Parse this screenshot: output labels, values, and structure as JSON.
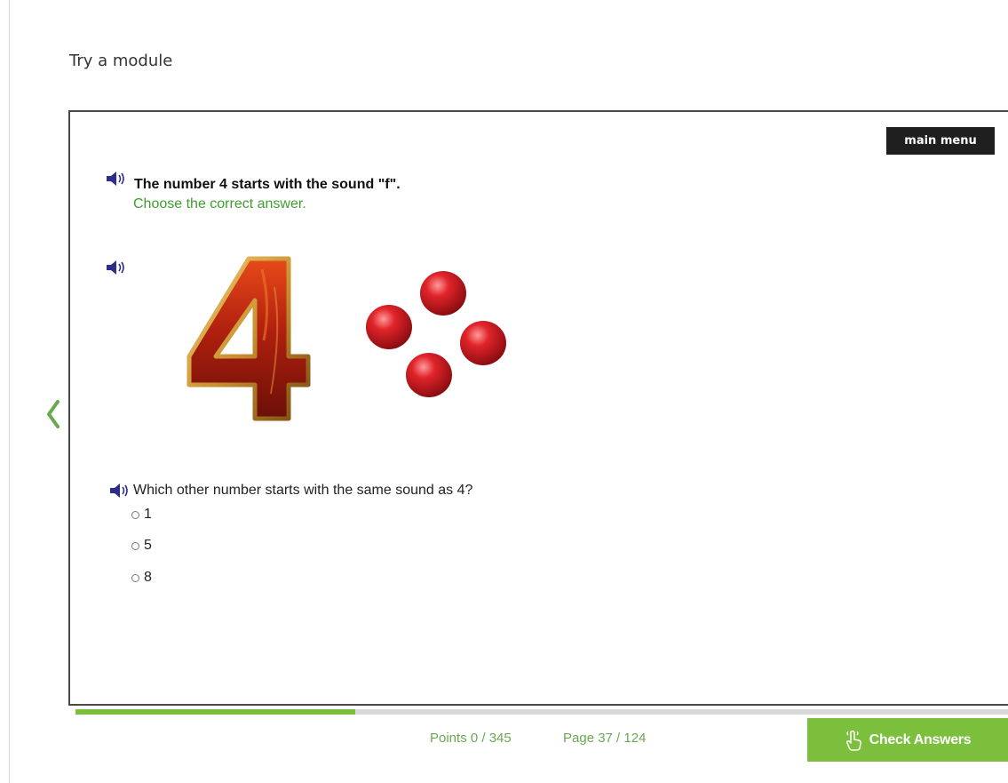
{
  "page": {
    "heading": "Try a module"
  },
  "module": {
    "main_menu_label": "main menu",
    "instruction": {
      "title": "The number 4 starts with the sound \"f\".",
      "subtitle": "Choose the correct answer."
    },
    "illustration": {
      "numeral": "4",
      "counter_count": 4
    },
    "question": {
      "text": "Which other number starts with the same sound as 4?",
      "options": [
        {
          "label": "1"
        },
        {
          "label": "5"
        },
        {
          "label": "8"
        }
      ]
    }
  },
  "footer": {
    "points": "Points 0 / 345",
    "page": "Page 37 / 124",
    "check_answers_label": "Check Answers",
    "progress_fraction": 0.3
  },
  "colors": {
    "accent_green": "#7cbf3d",
    "instruction_green": "#3e9e2e",
    "status_green": "#6aa84f",
    "speaker_blue": "#2e2e8a",
    "menu_dark": "#1f1f1f"
  },
  "icons": {
    "speaker": "speaker-icon",
    "prev": "chevron-left-icon",
    "check": "hand-pointer-icon"
  }
}
